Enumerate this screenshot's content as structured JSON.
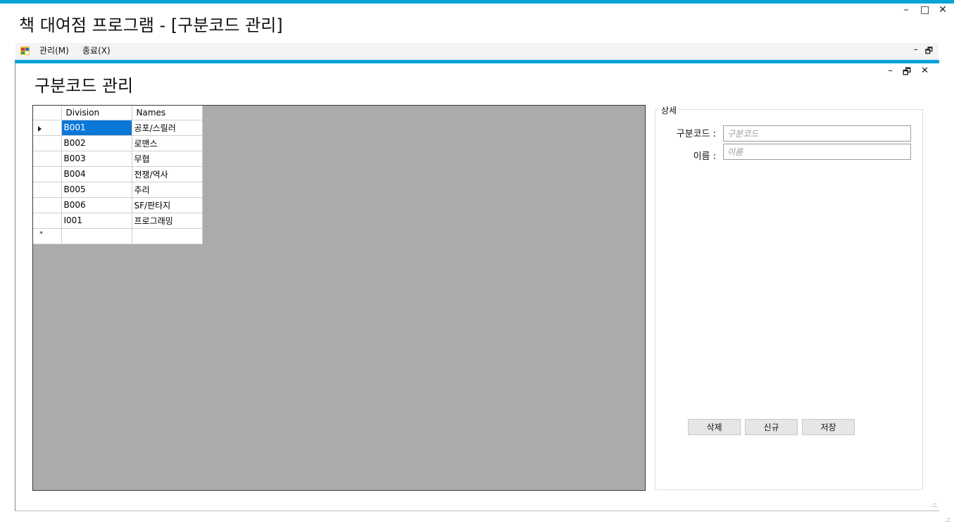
{
  "app": {
    "title": "책 대여점 프로그램 - [구분코드 관리]",
    "window_controls": {
      "minimize": "–",
      "maximize": "□",
      "close": "✕"
    }
  },
  "menubar": {
    "items": [
      {
        "label": "관리(M)"
      },
      {
        "label": "종료(X)"
      }
    ],
    "mdi_controls": {
      "minimize": "–",
      "restore": "🗗"
    }
  },
  "child": {
    "controls": {
      "minimize": "–",
      "restore": "🗗",
      "close": "✕"
    },
    "title": "구분코드 관리"
  },
  "grid": {
    "columns": [
      "Division",
      "Names"
    ],
    "rows": [
      {
        "division": "B001",
        "name": "공포/스릴러",
        "selected": true
      },
      {
        "division": "B002",
        "name": "로맨스"
      },
      {
        "division": "B003",
        "name": "무협"
      },
      {
        "division": "B004",
        "name": "전쟁/역사"
      },
      {
        "division": "B005",
        "name": "추리"
      },
      {
        "division": "B006",
        "name": "SF/판타지"
      },
      {
        "division": "I001",
        "name": "프로그래밍"
      }
    ],
    "new_row_marker": "*"
  },
  "detail": {
    "legend": "상세",
    "code_label": "구분코드 :",
    "code_placeholder": "구분코드",
    "name_label": "이름 :",
    "name_placeholder": "이름",
    "buttons": {
      "delete": "삭제",
      "new": "신규",
      "save": "저장"
    }
  },
  "colors": {
    "accent": "#0aa3d8",
    "selection": "#0a78d7",
    "grid_background": "#ababab"
  }
}
